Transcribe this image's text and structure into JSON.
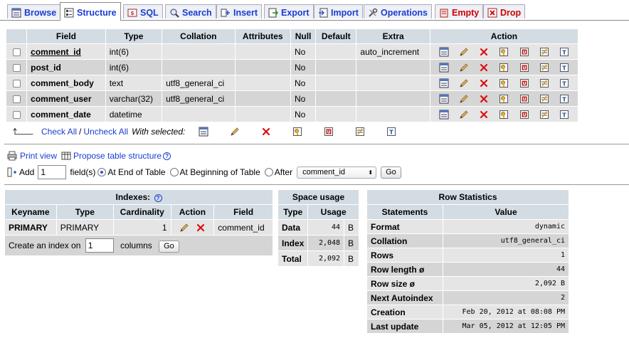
{
  "tabs": [
    {
      "label": "Browse",
      "icon": "browse-icon"
    },
    {
      "label": "Structure",
      "icon": "structure-icon",
      "active": true
    },
    {
      "label": "SQL",
      "icon": "sql-icon"
    },
    {
      "label": "Search",
      "icon": "search-icon"
    },
    {
      "label": "Insert",
      "icon": "insert-icon"
    },
    {
      "label": "Export",
      "icon": "export-icon"
    },
    {
      "label": "Import",
      "icon": "import-icon"
    },
    {
      "label": "Operations",
      "icon": "operations-icon"
    },
    {
      "label": "Empty",
      "icon": "empty-icon"
    },
    {
      "label": "Drop",
      "icon": "drop-icon"
    }
  ],
  "structure": {
    "headers": [
      "Field",
      "Type",
      "Collation",
      "Attributes",
      "Null",
      "Default",
      "Extra",
      "Action"
    ],
    "rows": [
      {
        "field": "comment_id",
        "type": "int(6)",
        "collation": "",
        "attributes": "",
        "null": "No",
        "default": "",
        "extra": "auto_increment",
        "underline": true
      },
      {
        "field": "post_id",
        "type": "int(6)",
        "collation": "",
        "attributes": "",
        "null": "No",
        "default": "",
        "extra": "",
        "underline": false
      },
      {
        "field": "comment_body",
        "type": "text",
        "collation": "utf8_general_ci",
        "attributes": "",
        "null": "No",
        "default": "",
        "extra": "",
        "underline": false
      },
      {
        "field": "comment_user",
        "type": "varchar(32)",
        "collation": "utf8_general_ci",
        "attributes": "",
        "null": "No",
        "default": "",
        "extra": "",
        "underline": false
      },
      {
        "field": "comment_date",
        "type": "datetime",
        "collation": "",
        "attributes": "",
        "null": "No",
        "default": "",
        "extra": "",
        "underline": false
      }
    ]
  },
  "check": {
    "check_all": "Check All",
    "slash": "/",
    "uncheck_all": "Uncheck All",
    "with_selected": "With selected:"
  },
  "print_view": "Print view",
  "propose": "Propose table structure",
  "add": {
    "label": "Add",
    "value": "1",
    "fields": "field(s)",
    "at_end": "At End of Table",
    "at_beginning": "At Beginning of Table",
    "after": "After",
    "after_select": "comment_id",
    "go": "Go"
  },
  "indexes": {
    "title": "Indexes:",
    "headers": [
      "Keyname",
      "Type",
      "Cardinality",
      "Action",
      "Field"
    ],
    "rows": [
      {
        "keyname": "PRIMARY",
        "type": "PRIMARY",
        "cardinality": "1",
        "field": "comment_id"
      }
    ],
    "create_prefix": "Create an index on",
    "create_value": "1",
    "create_suffix": "columns",
    "go": "Go"
  },
  "space": {
    "title": "Space usage",
    "headers": [
      "Type",
      "Usage"
    ],
    "rows": [
      {
        "type": "Data",
        "value": "44",
        "unit": "B"
      },
      {
        "type": "Index",
        "value": "2,048",
        "unit": "B"
      },
      {
        "type": "Total",
        "value": "2,092",
        "unit": "B"
      }
    ]
  },
  "stats": {
    "title": "Row Statistics",
    "headers": [
      "Statements",
      "Value"
    ],
    "rows": [
      {
        "label": "Format",
        "value": "dynamic"
      },
      {
        "label": "Collation",
        "value": "utf8_general_ci"
      },
      {
        "label": "Rows",
        "value": "1"
      },
      {
        "label": "Row length ø",
        "value": "44"
      },
      {
        "label": "Row size ø",
        "value": "2,092 B"
      },
      {
        "label": "Next Autoindex",
        "value": "2"
      },
      {
        "label": "Creation",
        "value": "Feb 20, 2012 at 08:08 PM"
      },
      {
        "label": "Last update",
        "value": "Mar 05, 2012 at 12:05 PM"
      }
    ]
  }
}
